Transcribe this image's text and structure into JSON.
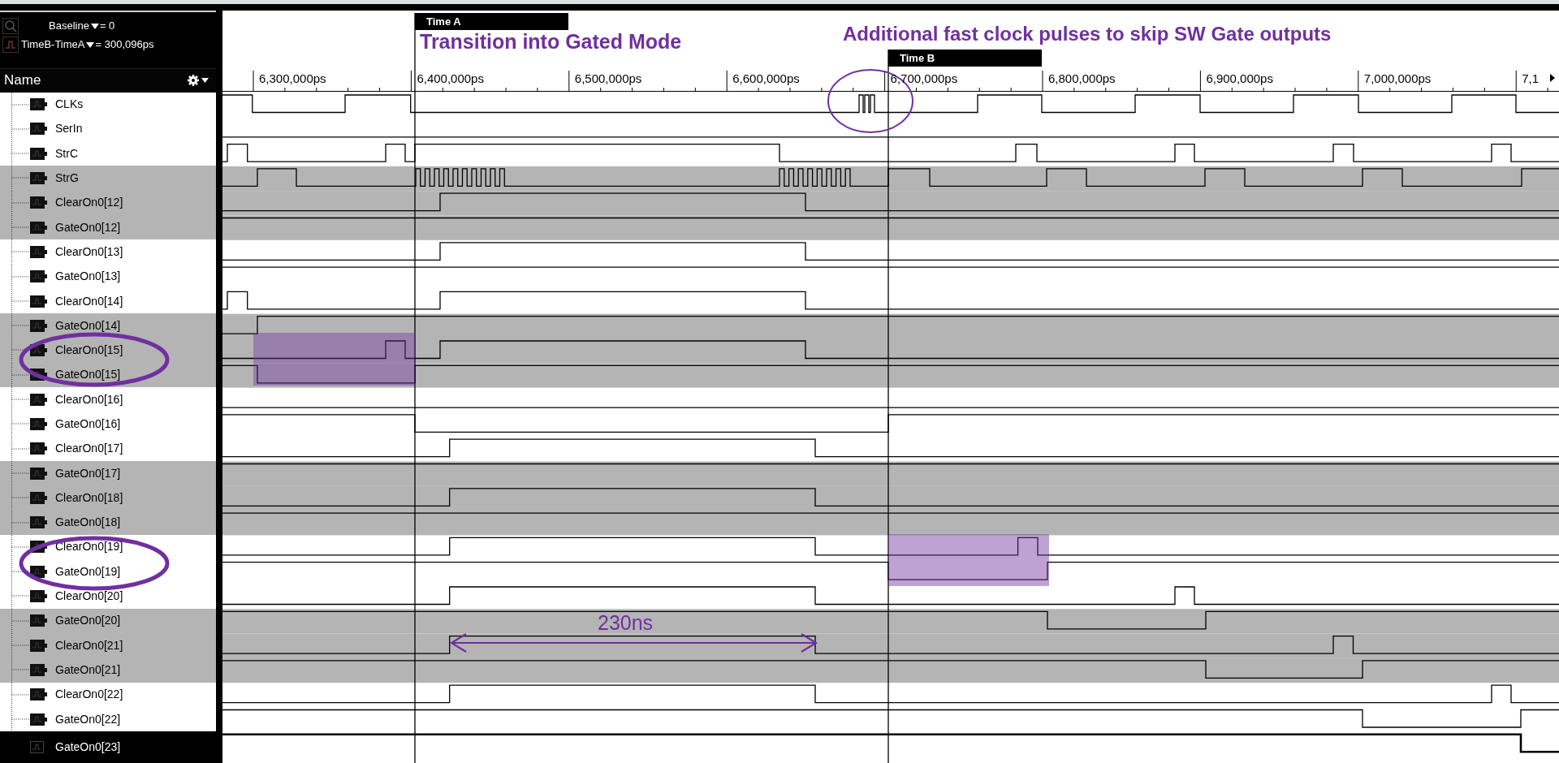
{
  "cursor_panel": {
    "baseline_label": "Baseline",
    "baseline_value": "= 0",
    "delta_label": "TimeB-TimeA",
    "delta_value": "= 300,096ps"
  },
  "name_header": "Name",
  "timeline": {
    "ticks": [
      "6,300,000ps",
      "6,400,000ps",
      "6,500,000ps",
      "6,600,000ps",
      "6,700,000ps",
      "6,800,000ps",
      "6,900,000ps",
      "7,000,000ps",
      "7,1"
    ],
    "cursors": [
      {
        "label": "Time A"
      },
      {
        "label": "Time B"
      }
    ]
  },
  "annotations": [
    {
      "text": "Transition into Gated Mode"
    },
    {
      "text": "Additional fast clock pulses to skip SW Gate outputs"
    },
    {
      "text": "230ns"
    }
  ],
  "signals": [
    {
      "name": "CLKs",
      "selected": false
    },
    {
      "name": "SerIn",
      "selected": false
    },
    {
      "name": "StrC",
      "selected": false
    },
    {
      "name": "StrG",
      "selected": false
    },
    {
      "name": "ClearOn0[12]",
      "selected": false
    },
    {
      "name": "GateOn0[12]",
      "selected": false
    },
    {
      "name": "ClearOn0[13]",
      "selected": false
    },
    {
      "name": "GateOn0[13]",
      "selected": false
    },
    {
      "name": "ClearOn0[14]",
      "selected": false
    },
    {
      "name": "GateOn0[14]",
      "selected": false
    },
    {
      "name": "ClearOn0[15]",
      "selected": false
    },
    {
      "name": "GateOn0[15]",
      "selected": false
    },
    {
      "name": "ClearOn0[16]",
      "selected": false
    },
    {
      "name": "GateOn0[16]",
      "selected": false
    },
    {
      "name": "ClearOn0[17]",
      "selected": false
    },
    {
      "name": "GateOn0[17]",
      "selected": false
    },
    {
      "name": "ClearOn0[18]",
      "selected": false
    },
    {
      "name": "GateOn0[18]",
      "selected": false
    },
    {
      "name": "ClearOn0[19]",
      "selected": false
    },
    {
      "name": "GateOn0[19]",
      "selected": false
    },
    {
      "name": "ClearOn0[20]",
      "selected": false
    },
    {
      "name": "GateOn0[20]",
      "selected": false
    },
    {
      "name": "ClearOn0[21]",
      "selected": false
    },
    {
      "name": "GateOn0[21]",
      "selected": false
    },
    {
      "name": "ClearOn0[22]",
      "selected": false
    },
    {
      "name": "GateOn0[22]",
      "selected": false
    },
    {
      "name": "GateOn0[23]",
      "selected": true
    }
  ]
}
